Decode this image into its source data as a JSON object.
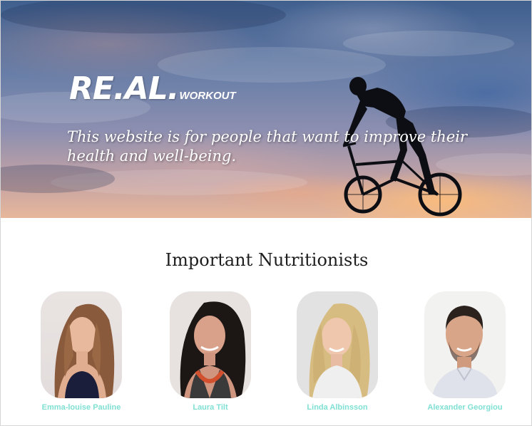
{
  "hero": {
    "logo_main": "RE.AL.",
    "logo_sub": "WORKOUT",
    "tagline": "This website is for people that want to improve their health and well-being."
  },
  "section": {
    "title": "Important Nutritionists"
  },
  "nutritionists": [
    {
      "name": "Emma-louise Pauline"
    },
    {
      "name": "Laura Tilt"
    },
    {
      "name": "Linda Albinsson"
    },
    {
      "name": "Alexander Georgiou"
    }
  ],
  "colors": {
    "name_text": "#7fe0d4",
    "title_text": "#1e1e1e"
  }
}
